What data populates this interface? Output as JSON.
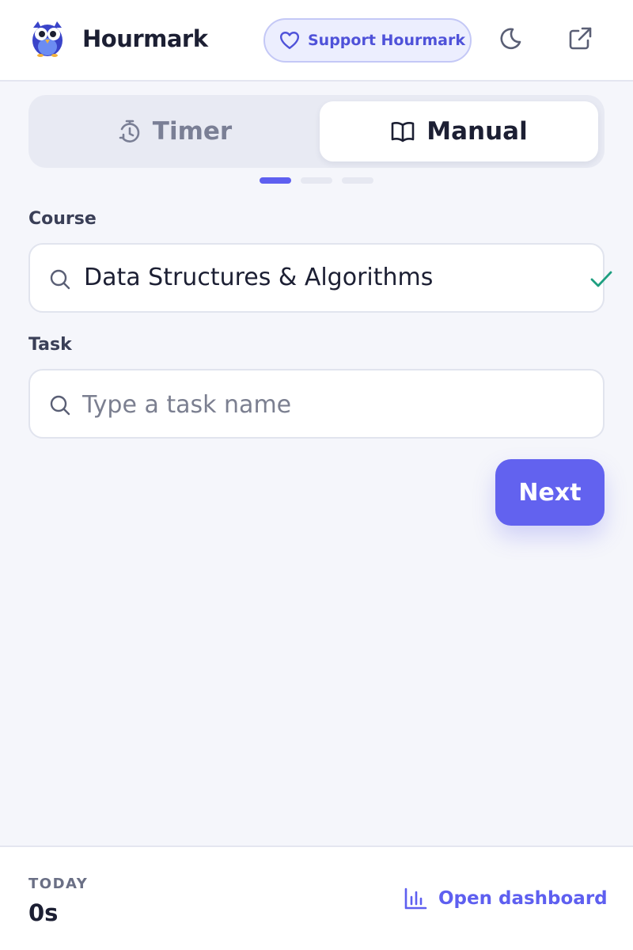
{
  "header": {
    "brand": "Hourmark",
    "support_label": "Support Hourmark",
    "icons": [
      "owl-logo",
      "heart-icon",
      "moon-icon",
      "external-link-icon"
    ]
  },
  "mode_tabs": {
    "timer_label": "Timer",
    "manual_label": "Manual",
    "selected": "Manual",
    "step_indicator": {
      "current": 1,
      "total": 3
    }
  },
  "form": {
    "course": {
      "label": "Course",
      "value": "Data Structures & Algorithms",
      "validated": true
    },
    "task": {
      "label": "Task",
      "placeholder": "Type a task name",
      "value": ""
    },
    "next_label": "Next"
  },
  "footer": {
    "today_label": "TODAY",
    "today_value": "0s",
    "dashboard_label": "Open dashboard"
  },
  "colors": {
    "accent": "#6262ef",
    "background": "#f5f6fb",
    "check": "#1e9f80",
    "support_bg": "#eceefe",
    "support_text": "#4f52d9"
  }
}
